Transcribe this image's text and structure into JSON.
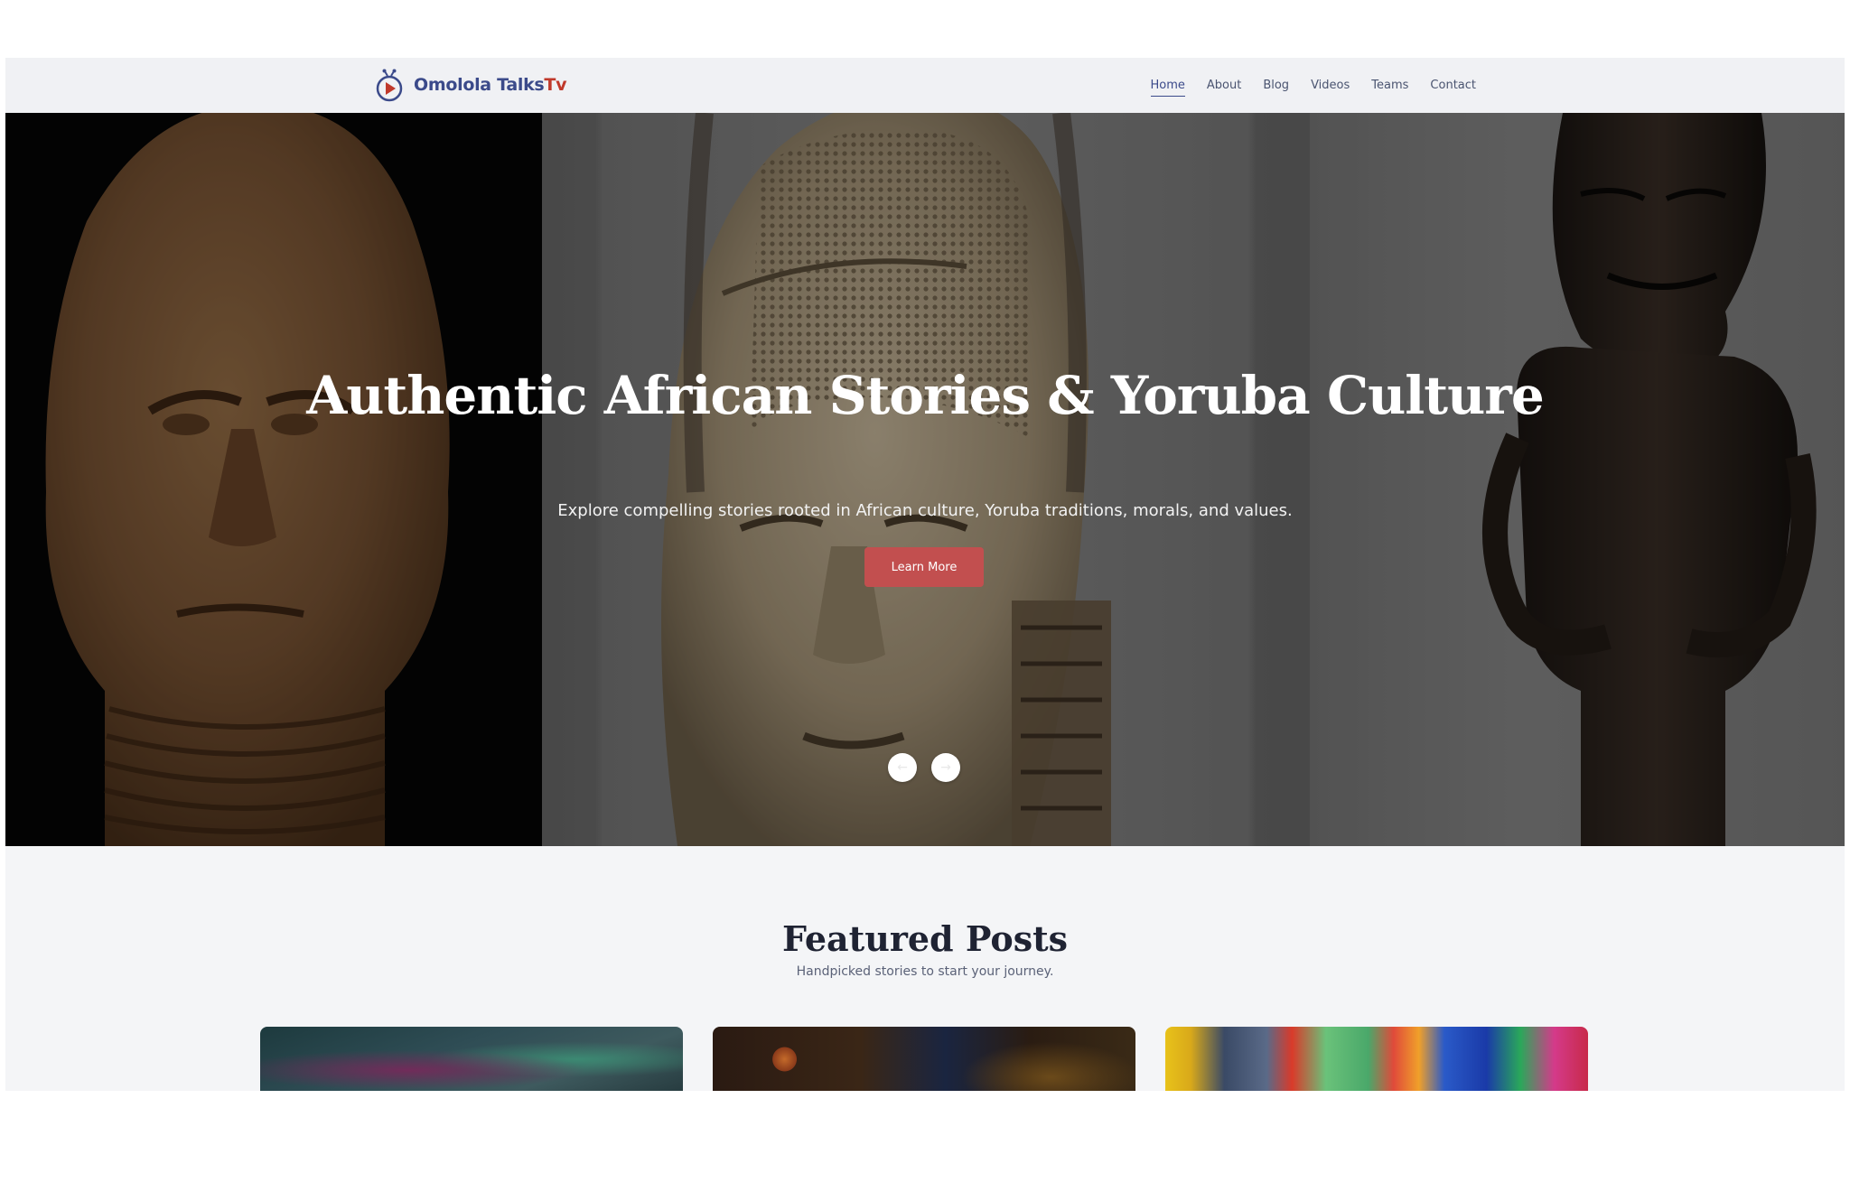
{
  "header": {
    "brand_name": "Omolola Talks",
    "brand_accent": "Tv",
    "logo_icon": "play-logo-icon",
    "nav": [
      {
        "label": "Home",
        "active": true
      },
      {
        "label": "About",
        "active": false
      },
      {
        "label": "Blog",
        "active": false
      },
      {
        "label": "Videos",
        "active": false
      },
      {
        "label": "Teams",
        "active": false
      },
      {
        "label": "Contact",
        "active": false
      }
    ]
  },
  "hero": {
    "title": "Authentic African Stories & Yoruba Culture",
    "subtitle": "Explore compelling stories rooted in African culture, Yoruba traditions, morals, and values.",
    "cta_label": "Learn More",
    "prev_icon": "arrow-left-icon",
    "next_icon": "arrow-right-icon",
    "images": [
      "terracotta-head-sculpture",
      "ivory-mask-sculpture",
      "wooden-figure-sculpture"
    ]
  },
  "featured": {
    "title": "Featured Posts",
    "subtitle": "Handpicked stories to start your journey."
  },
  "colors": {
    "brand_blue": "#3b4a8a",
    "brand_red": "#c0392b",
    "cta_red": "#c24f4f",
    "navbar_bg": "#f0f1f4",
    "page_bg": "#f4f5f7"
  }
}
